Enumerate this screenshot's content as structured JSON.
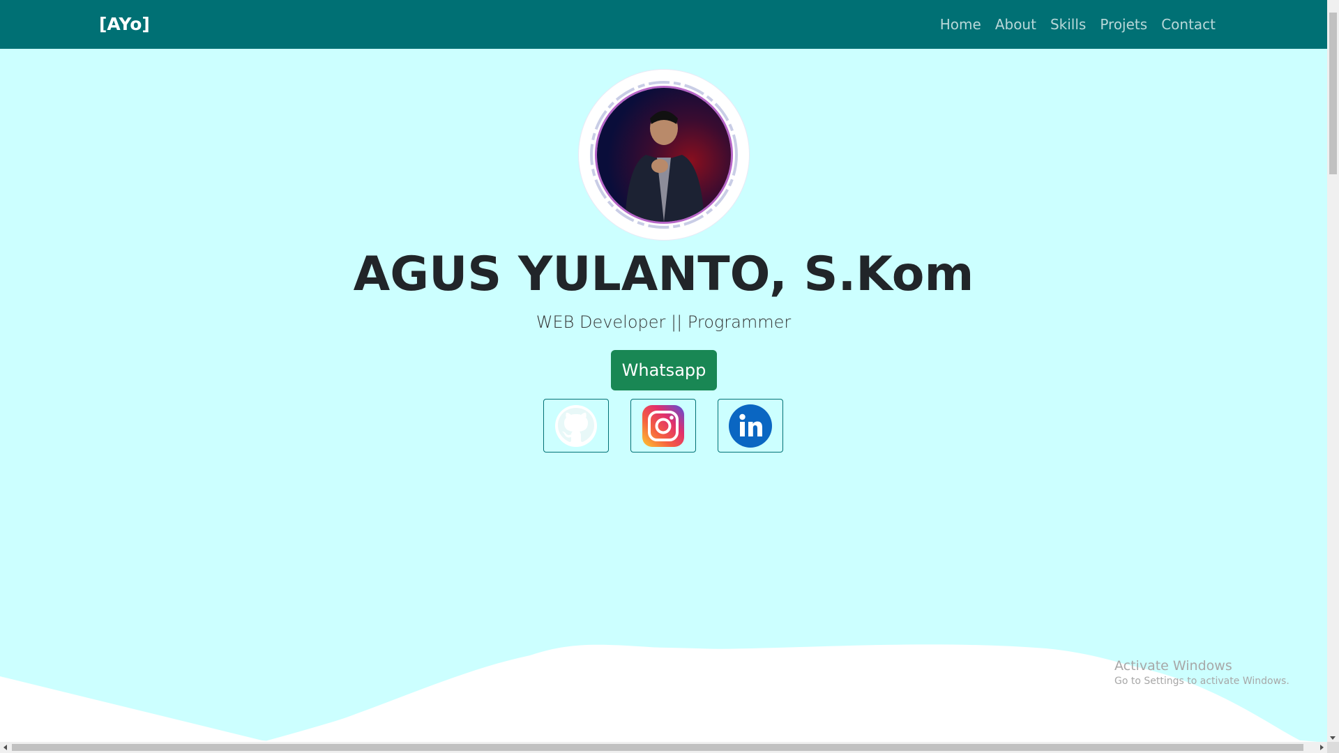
{
  "navbar": {
    "brand": "[AYo]",
    "links": [
      "Home",
      "About",
      "Skills",
      "Projets",
      "Contact"
    ]
  },
  "hero": {
    "name": "AGUS YULANTO, S.Kom",
    "subtitle": "WEB Developer || Programmer",
    "whatsapp_label": "Whatsapp",
    "social": [
      {
        "icon": "github-icon"
      },
      {
        "icon": "instagram-icon"
      },
      {
        "icon": "linkedin-icon"
      }
    ]
  },
  "watermark": {
    "title": "Activate Windows",
    "subtitle": "Go to Settings to activate Windows."
  },
  "colors": {
    "navbar": "#007074",
    "background": "#ccffff",
    "whatsapp": "#198754",
    "linkedin": "#0a66c2"
  }
}
